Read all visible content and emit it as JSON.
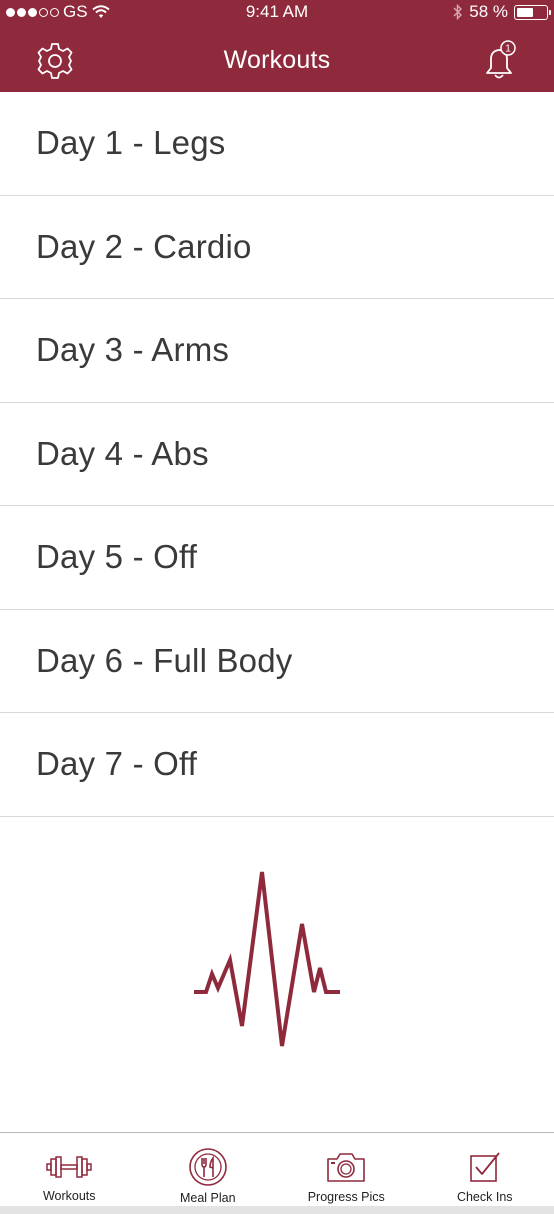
{
  "status_bar": {
    "carrier": "GS",
    "time": "9:41 AM",
    "battery_text": "58 %",
    "battery_level": 0.58
  },
  "nav": {
    "title": "Workouts",
    "notification_count": "1"
  },
  "workouts": [
    {
      "label": "Day 1 - Legs"
    },
    {
      "label": "Day 2 - Cardio"
    },
    {
      "label": "Day 3 - Arms"
    },
    {
      "label": "Day 4 - Abs"
    },
    {
      "label": "Day 5 - Off"
    },
    {
      "label": "Day 6 - Full Body"
    },
    {
      "label": "Day 7 - Off"
    }
  ],
  "tabs": [
    {
      "label": "Workouts",
      "icon": "dumbbell-icon"
    },
    {
      "label": "Meal Plan",
      "icon": "fork-knife-plate-icon"
    },
    {
      "label": "Progress Pics",
      "icon": "camera-icon"
    },
    {
      "label": "Check Ins",
      "icon": "checkbox-icon"
    }
  ],
  "colors": {
    "brand": "#8f2a3d",
    "text": "#3a3a3a",
    "divider": "#d9d9d9"
  }
}
